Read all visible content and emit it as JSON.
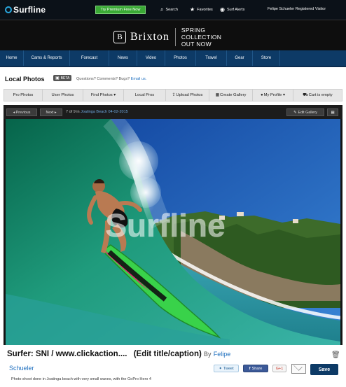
{
  "topbar": {
    "logo_text": "Surfline",
    "premium_label": "Try Premium Free Now",
    "search_label": "Search",
    "favorites_label": "Favorites",
    "surf_alerts_label": "Surf Alerts",
    "user_text": "Felipe Schueler Registered Visitor"
  },
  "banner": {
    "brand_initial": "B",
    "brand_name": "Brixton",
    "promo_line1": "SPRING",
    "promo_line2": "COLLECTION",
    "promo_line3": "OUT NOW"
  },
  "mainnav": {
    "items": [
      "Home",
      "Cams & Reports",
      "Forecast",
      "News",
      "Video",
      "Photos",
      "Travel",
      "Gear",
      "Store"
    ]
  },
  "local_photos": {
    "title": "Local Photos",
    "beta_label": "BETA",
    "questions_text": "Questions? Comments? Bugs?",
    "email_link": "Email us."
  },
  "subnav": {
    "items": [
      "Pro Photos",
      "User Photos",
      "Find Photos ▾",
      "Local Pros",
      "Upload Photos",
      "Create Gallery",
      "My Profile ▾",
      "Cart is empty"
    ]
  },
  "viewer": {
    "previous_label": "◂ Previous",
    "next_label": "Next ▸",
    "counter_text": "7 of 9 in",
    "gallery_link": "Joatinga Beach 04-02-2015",
    "edit_gallery_label": "Edit Gallery",
    "watermark": "Surfline"
  },
  "caption": {
    "title": "Surfer: SNI / www.clickaction....",
    "edit_label": "(Edit title/caption)",
    "by": "By",
    "author_first": "Felipe",
    "author_last": "Schueler",
    "description": "Photo shoot done in Joatinga beach with very small waves, with the GoPro Hero 4",
    "tweet_label": "Tweet",
    "share_label": "Share",
    "gplus_label": "G+1",
    "save_label": "Save"
  },
  "colors": {
    "nav_blue": "#0d3a66",
    "premium_green": "#3aa935",
    "board_green": "#39d24a",
    "link_blue": "#1e6fbf"
  }
}
